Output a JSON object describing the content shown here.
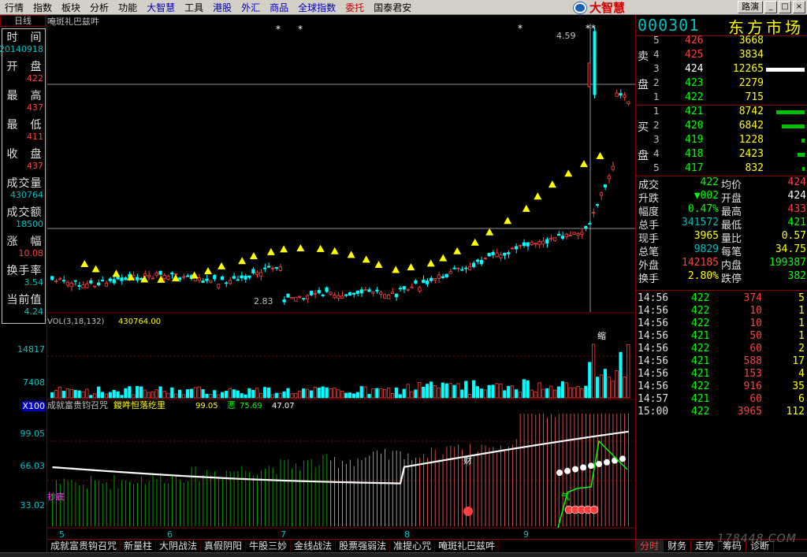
{
  "menu": [
    {
      "label": "行情",
      "style": ""
    },
    {
      "label": "指数",
      "style": ""
    },
    {
      "label": "板块",
      "style": ""
    },
    {
      "label": "分析",
      "style": ""
    },
    {
      "label": "功能",
      "style": ""
    },
    {
      "label": "大智慧",
      "style": "blue"
    },
    {
      "label": "工具",
      "style": ""
    },
    {
      "label": "港股",
      "style": "blue"
    },
    {
      "label": "外汇",
      "style": "blue"
    },
    {
      "label": "商品",
      "style": "blue"
    },
    {
      "label": "全球指数",
      "style": "blue"
    },
    {
      "label": "委托",
      "style": "red"
    },
    {
      "label": "国泰君安",
      "style": ""
    }
  ],
  "brand": {
    "name": "大智慧"
  },
  "route_button": "路演",
  "window_buttons": {
    "min": "_",
    "max": "□",
    "close": "×"
  },
  "left_panel": {
    "period": "日线",
    "items": [
      {
        "label": "时　间",
        "value": "20140918",
        "color": "cyan"
      },
      {
        "label": "开　盘",
        "value": "422",
        "color": "red"
      },
      {
        "label": "最　高",
        "value": "437",
        "color": "red"
      },
      {
        "label": "最　低",
        "value": "411",
        "color": "red"
      },
      {
        "label": "收　盘",
        "value": "437",
        "color": "red"
      },
      {
        "label": "成交量",
        "value": "430764",
        "color": "cyan"
      },
      {
        "label": "成交额",
        "value": "18500",
        "color": "cyan"
      },
      {
        "label": "涨　幅",
        "value": "10.08",
        "color": "red"
      },
      {
        "label": "换手率",
        "value": "3.54",
        "color": "cyan"
      },
      {
        "label": "当前值",
        "value": "4.24",
        "color": "cyan"
      }
    ],
    "vol_scale": [
      "14817",
      "7408",
      "X100"
    ],
    "ind_scale": [
      "99.05",
      "66.03",
      "33.02"
    ]
  },
  "chart": {
    "title": "唵斑礼巴兹吽",
    "price_marker": "4.59",
    "low_marker": "2.83",
    "vol_caption": {
      "name": "VOL(3,18,132)",
      "value": "430764.00"
    },
    "ind_caption": {
      "name": "成就富贵钧召咒",
      "name2": "鍐吽怛落纥里",
      "v1": "99.05",
      "label2": "恶",
      "v2": "75.69",
      "v3": "47.07"
    },
    "x_ticks": [
      "5",
      "6",
      "7",
      "8",
      "9"
    ],
    "ind_labels": {
      "left": "抄底",
      "cai": "财",
      "qi": "气",
      "shou": "缩"
    }
  },
  "chart_data": {
    "type": "candlestick",
    "x_ticks": [
      "5",
      "6",
      "7",
      "8",
      "9"
    ],
    "close_last": 4.37,
    "high_marker": 4.59,
    "low_marker": 2.83,
    "vol_max": 14817,
    "indicator_levels": [
      99.05,
      66.03,
      33.02
    ]
  },
  "quote": {
    "code": "000301",
    "market": "东方市场",
    "sell": [
      {
        "lvl": "5",
        "price": "426",
        "vol": "3668",
        "color": "red",
        "bar": 0
      },
      {
        "lvl": "4",
        "price": "425",
        "vol": "3834",
        "color": "red",
        "bar": 0
      },
      {
        "lvl": "3",
        "price": "424",
        "vol": "12265",
        "color": "white",
        "bar": 0.95
      },
      {
        "lvl": "2",
        "price": "423",
        "vol": "2279",
        "color": "green",
        "bar": 0
      },
      {
        "lvl": "1",
        "price": "422",
        "vol": "715",
        "color": "green",
        "bar": 0
      }
    ],
    "buy": [
      {
        "lvl": "1",
        "price": "421",
        "vol": "8742",
        "color": "green",
        "bar": 0.7
      },
      {
        "lvl": "2",
        "price": "420",
        "vol": "6842",
        "color": "green",
        "bar": 0.55
      },
      {
        "lvl": "3",
        "price": "419",
        "vol": "1228",
        "color": "green",
        "bar": 0.08
      },
      {
        "lvl": "4",
        "price": "418",
        "vol": "2423",
        "color": "green",
        "bar": 0.18
      },
      {
        "lvl": "5",
        "price": "417",
        "vol": "832",
        "color": "green",
        "bar": 0.05
      }
    ],
    "side_labels": {
      "sell_top": "卖",
      "sell_bot": "盘",
      "buy_top": "买",
      "buy_bot": "盘"
    },
    "stats": [
      {
        "l": "成交",
        "lv": "422",
        "lc": "green",
        "r": "均价",
        "rv": "424",
        "rc": "red"
      },
      {
        "l": "升跌",
        "lv": "▼002",
        "lc": "green",
        "r": "开盘",
        "rv": "424",
        "rc": "white"
      },
      {
        "l": "幅度",
        "lv": "0.47%",
        "lc": "green",
        "r": "最高",
        "rv": "433",
        "rc": "red"
      },
      {
        "l": "总手",
        "lv": "341572",
        "lc": "cyan",
        "r": "最低",
        "rv": "421",
        "rc": "green"
      },
      {
        "l": "现手",
        "lv": "3965",
        "lc": "yellow",
        "r": "量比",
        "rv": "0.57",
        "rc": "yellow"
      },
      {
        "l": "总笔",
        "lv": "9829",
        "lc": "cyan",
        "r": "每笔",
        "rv": "34.75",
        "rc": "yellow"
      },
      {
        "l": "外盘",
        "lv": "142185",
        "lc": "red",
        "r": "内盘",
        "rv": "199387",
        "rc": "green"
      },
      {
        "l": "换手",
        "lv": "2.80%",
        "lc": "yellow",
        "r": "跌停",
        "rv": "382",
        "rc": "green"
      }
    ],
    "ticks": [
      {
        "t": "14:56",
        "p": "422",
        "v": "374",
        "n": "5"
      },
      {
        "t": "14:56",
        "p": "422",
        "v": "10",
        "n": "1"
      },
      {
        "t": "14:56",
        "p": "422",
        "v": "10",
        "n": "1"
      },
      {
        "t": "14:56",
        "p": "421",
        "v": "50",
        "n": "1"
      },
      {
        "t": "14:56",
        "p": "422",
        "v": "60",
        "n": "2"
      },
      {
        "t": "14:56",
        "p": "421",
        "v": "588",
        "n": "17"
      },
      {
        "t": "14:56",
        "p": "421",
        "v": "153",
        "n": "4"
      },
      {
        "t": "14:56",
        "p": "422",
        "v": "916",
        "n": "35"
      },
      {
        "t": "14:57",
        "p": "421",
        "v": "60",
        "n": "6"
      },
      {
        "t": "15:00",
        "p": "422",
        "v": "3965",
        "n": "112"
      }
    ],
    "tabs": [
      "分时",
      "财务",
      "走势",
      "筹码",
      "诊断"
    ]
  },
  "bottom_tabs": [
    "成就富贵钩召咒",
    "新量柱",
    "大阴战法",
    "真假阴阳",
    "牛股三妙",
    "金线战法",
    "股票强弱法",
    "准提心咒",
    "唵斑礼巴兹吽"
  ],
  "watermark": "178448.COM",
  "colors": {
    "up": "#ff4040",
    "down": "#00ffff",
    "ma": "#ffffff",
    "grid": "#800000"
  }
}
